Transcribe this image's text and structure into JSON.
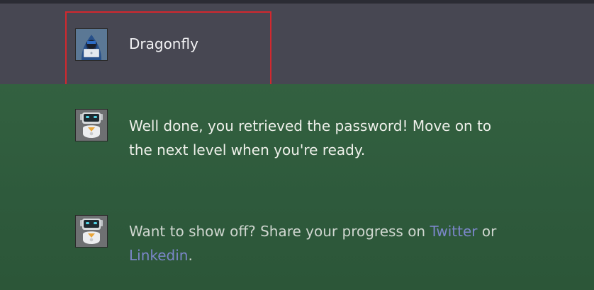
{
  "user_message": {
    "name": "Dragonfly",
    "avatar_icon": "hooded-hacker-avatar-icon"
  },
  "bot_messages": [
    {
      "avatar_icon": "robot-avatar-icon",
      "line1": "Well done, you retrieved the password! Move on to",
      "line2": "the next level when you're ready."
    },
    {
      "avatar_icon": "robot-avatar-icon",
      "text_before": "Want to show off? Share your progress on ",
      "link1": "Twitter",
      "text_middle": " or",
      "link2": "Linkedin",
      "text_after": "."
    }
  ],
  "colors": {
    "user_row_bg": "#474752",
    "bot_bg": "#2f5a3d",
    "highlight_border": "#d2282e",
    "link": "#7b86c8"
  }
}
